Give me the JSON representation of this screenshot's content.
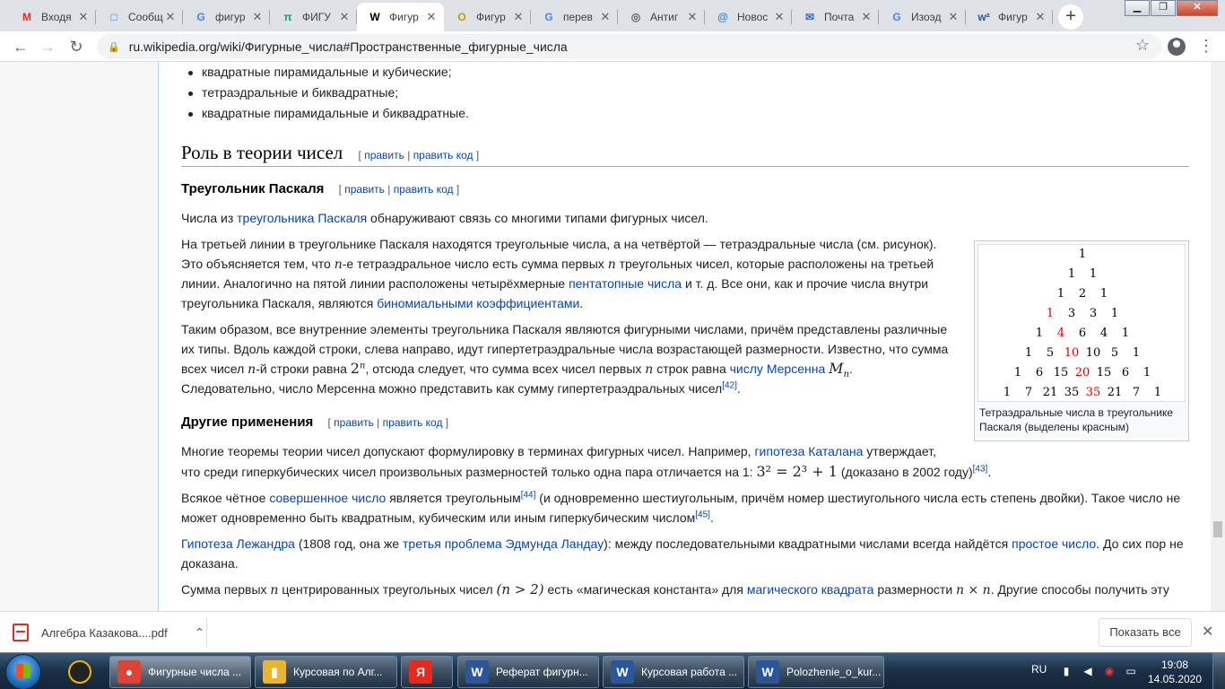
{
  "browser": {
    "tabs": [
      {
        "title": "Входя",
        "icon": "gmail-icon",
        "color": "#d93025",
        "glyph": "M"
      },
      {
        "title": "Сообщ",
        "icon": "vk-icon",
        "color": "#2787f5",
        "glyph": "□"
      },
      {
        "title": "фигур",
        "icon": "google-icon",
        "color": "#4285f4",
        "glyph": "G"
      },
      {
        "title": "ФИГУ",
        "icon": "pi-icon",
        "color": "#1a9c6b",
        "glyph": "π"
      },
      {
        "title": "Фигур",
        "icon": "wikipedia-icon",
        "color": "#000000",
        "glyph": "W",
        "active": true
      },
      {
        "title": "Фигур",
        "icon": "o-icon",
        "color": "#c99a00",
        "glyph": "O"
      },
      {
        "title": "перев",
        "icon": "google-icon",
        "color": "#4285f4",
        "glyph": "G"
      },
      {
        "title": "Антиг",
        "icon": "eye-icon",
        "color": "#5f6368",
        "glyph": "◎"
      },
      {
        "title": "Новос",
        "icon": "mail-ru-icon",
        "color": "#168de2",
        "glyph": "@"
      },
      {
        "title": "Почта",
        "icon": "mail-icon",
        "color": "#2f6fdc",
        "glyph": "✉"
      },
      {
        "title": "Изоэд",
        "icon": "google-icon",
        "color": "#4285f4",
        "glyph": "G"
      },
      {
        "title": "Фигур",
        "icon": "word-icon",
        "color": "#2b579a",
        "glyph": "w²"
      }
    ],
    "url": "ru.wikipedia.org/wiki/Фигурные_числа#Пространственные_фигурные_числа"
  },
  "article": {
    "bullets": [
      "квадратные пирамидальные и кубические;",
      "тетраэдральные и биквадратные;",
      "квадратные пирамидальные и биквадратные."
    ],
    "section_title": "Роль в теории чисел",
    "edit": {
      "open": "[",
      "edit": "править",
      "sep": "|",
      "edit_code": "править код",
      "close": "]"
    },
    "sub1_title": "Треугольник Паскаля",
    "sub2_title": "Другие применения",
    "p1": {
      "before": "Числа из ",
      "link": "треугольника Паскаля",
      "after": " обнаруживают связь со многими типами фигурных чисел."
    },
    "p2": {
      "l1": "На третьей линии в треугольнике Паскаля находятся треугольные числа, а на четвёртой — тетраэдральные числа (см. рисунок).",
      "l2a": "Это объясняется тем, что ",
      "n": "n",
      "l2b": "-е тетраэдральное число есть сумма первых ",
      "l2c": " треугольных чисел, которые расположены на третьей",
      "l3a": "линии. Аналогично на пятой линии расположены четырёхмерные ",
      "l3link": "пентатопные числа",
      "l3b": " и т. д. Все они, как и прочие числа внутри",
      "l4a": "треугольника Паскаля, являются ",
      "l4link": "биномиальными коэффициентами",
      "l4b": "."
    },
    "p3": {
      "l1": "Таким образом, все внутренние элементы треугольника Паскаля являются фигурными числами, причём представлены различные",
      "l2": "их типы. Вдоль каждой строки, слева направо, идут гипертетраэдральные числа возрастающей размерности. Известно, что сумма",
      "l3a": "всех чисел ",
      "l3b": "-й строки равна ",
      "pow": "2",
      "powsup": "n",
      "l3c": ", отсюда следует, что сумма всех чисел первых ",
      "l3d": " строк равна ",
      "l3link": "числу Мерсенна",
      "mersenne": "M",
      "mersub": "n",
      "l3e": ".",
      "l4": "Следовательно, число Мерсенна можно представить как сумму гипертетраэдральных чисел",
      "ref": "[42]",
      "l4end": "."
    },
    "p4": {
      "l1a": "Многие теоремы теории чисел допускают формулировку в терминах фигурных чисел. Например, ",
      "l1link": "гипотеза Каталана",
      "l1b": " утверждает,",
      "l2a": "что среди гиперкубических чисел произвольных размерностей только одна пара отличается на 1: ",
      "formula": "3² = 2³ + 1",
      "l2b": " (доказано в 2002 году)",
      "ref": "[43]",
      "l2end": "."
    },
    "p5": {
      "l1a": "Всякое чётное ",
      "l1link": "совершенное число",
      "l1b": " является треугольным",
      "ref1": "[44]",
      "l1c": " (и одновременно шестиугольным, причём номер шестиугольного числа есть степень двойки). Такое число не",
      "l2": "может одновременно быть квадратным, кубическим или иным гиперкубическим числом",
      "ref2": "[45]",
      "l2end": "."
    },
    "p6": {
      "l1link": "Гипотеза Лежандра",
      "l1a": " (1808 год, она же ",
      "l1link2": "третья проблема Эдмунда Ландау",
      "l1b": "): между последовательными квадратными числами всегда найдётся ",
      "l1link3": "простое число",
      "l1c": ". До сих пор не",
      "l2": "доказана."
    },
    "p7": {
      "l1a": "Сумма первых ",
      "l1b": " центрированных треугольных чисел ",
      "cond": "(n > 2)",
      "l1c": " есть «магическая константа» для ",
      "l1link": "магического квадрата",
      "l1d": " размерности ",
      "dim": "n × n",
      "l1e": ". Другие способы получить эту"
    },
    "figure": {
      "rows": [
        [
          "1"
        ],
        [
          "1",
          "1"
        ],
        [
          "1",
          "2",
          "1"
        ],
        [
          "1",
          "3",
          "3",
          "1"
        ],
        [
          "1",
          "4",
          "6",
          "4",
          "1"
        ],
        [
          "1",
          "5",
          "10",
          "10",
          "5",
          "1"
        ],
        [
          "1",
          "6",
          "15",
          "20",
          "15",
          "6",
          "1"
        ],
        [
          "1",
          "7",
          "21",
          "35",
          "35",
          "21",
          "7",
          "1"
        ]
      ],
      "caption": "Тетраэдральные числа в треугольнике Паскаля (выделены красным)"
    }
  },
  "downloads": {
    "file": "Алгебра Казакова....pdf",
    "show_all": "Показать все"
  },
  "taskbar": {
    "items": [
      {
        "label": "Фигурные числа ...",
        "icon": "chrome-icon",
        "color": "#db4437",
        "glyph": "●",
        "active": true
      },
      {
        "label": "Курсовая по Алг...",
        "icon": "folder-icon",
        "color": "#e8b530",
        "glyph": "▮"
      },
      {
        "label": "",
        "icon": "yandex-icon",
        "color": "#e42a1c",
        "glyph": "Я"
      },
      {
        "label": "Реферат фигурн...",
        "icon": "word-icon",
        "color": "#2b579a",
        "glyph": "W"
      },
      {
        "label": "Курсовая работа ...",
        "icon": "word-icon",
        "color": "#2b579a",
        "glyph": "W"
      },
      {
        "label": "Polozhenie_o_kur...",
        "icon": "word-icon",
        "color": "#2b579a",
        "glyph": "W"
      }
    ],
    "lang": "RU",
    "time": "19:08",
    "date": "14.05.2020"
  }
}
